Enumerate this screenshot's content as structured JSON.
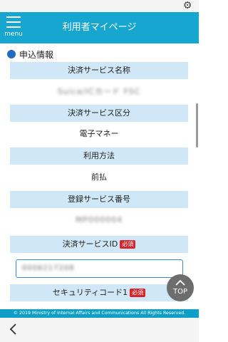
{
  "header": {
    "title": "利用者マイページ",
    "menu_label": "menu"
  },
  "section": {
    "heading": "申込情報"
  },
  "rows": [
    {
      "label": "決済サービス名称",
      "value": "Suica/ICカード FSC"
    },
    {
      "label": "決済サービス区分",
      "value": "電子マネー"
    },
    {
      "label": "利用方法",
      "value": "前払"
    },
    {
      "label": "登録サービス番号",
      "value": "MP000004"
    }
  ],
  "payment_id": {
    "label": "決済サービスID",
    "required": "必須",
    "value": "0006217208"
  },
  "security_code": {
    "label": "セキュリティコード1",
    "required": "必須"
  },
  "top_button": {
    "label": "TOP"
  },
  "footer": {
    "text": "© 2019 Ministry of Internal Affairs and Communications All Rights Reserved."
  },
  "colors": {
    "header": "#17a6cf",
    "row_head": "#cfe7f6",
    "required": "#d6262c",
    "bullet": "#1f6cc0"
  }
}
